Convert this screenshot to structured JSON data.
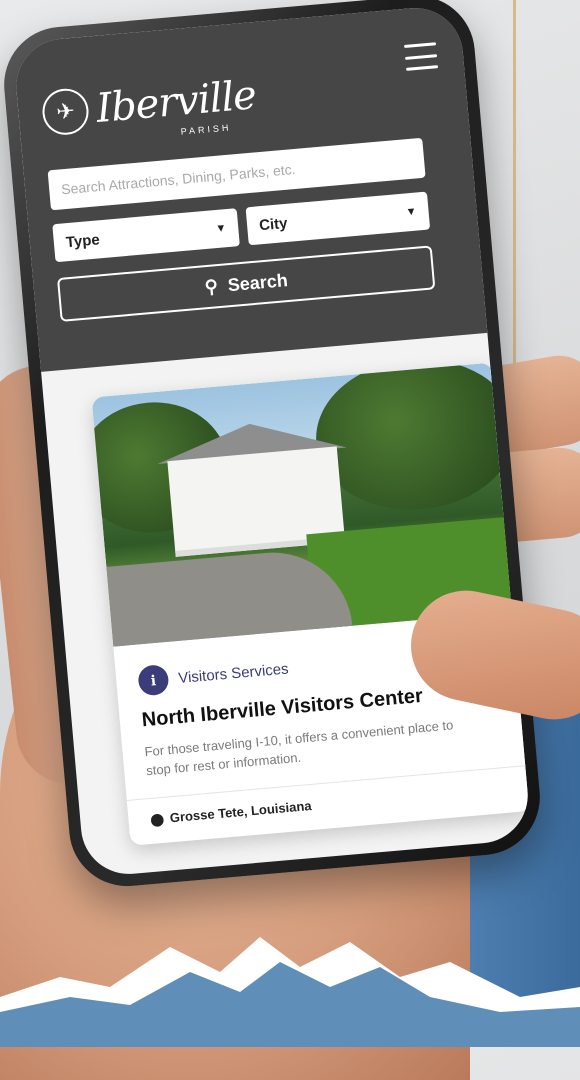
{
  "app": {
    "logo_text": "Iberville",
    "logo_subtext": "PARISH"
  },
  "search": {
    "placeholder": "Search Attractions, Dining, Parks, etc.",
    "type_label": "Type",
    "city_label": "City",
    "button_label": "Search"
  },
  "listing": {
    "category": "Visitors Services",
    "title": "North Iberville Visitors Center",
    "description": "For those traveling I-10, it offers a convenient place to stop for rest or information.",
    "location": "Grosse Tete, Louisiana"
  },
  "colors": {
    "header_bg": "#464646",
    "accent": "#3a3d7a"
  },
  "icons": [
    "menu-icon",
    "search-icon",
    "visitor-services-icon",
    "location-pin-icon",
    "caret-down-icon",
    "pelican-logo-icon"
  ]
}
